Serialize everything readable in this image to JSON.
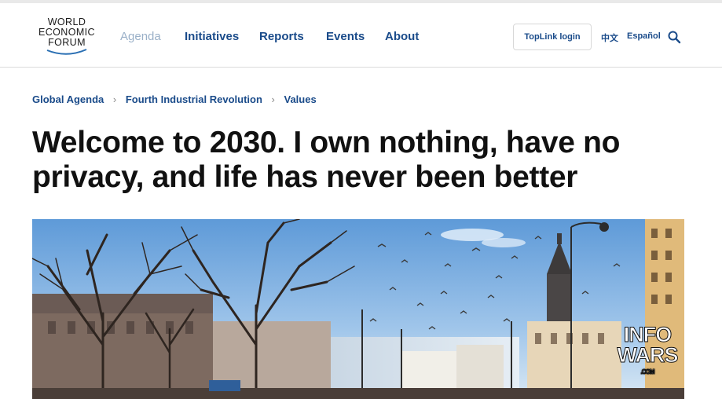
{
  "logo": {
    "line1": "WORLD",
    "line2": "ECONOMIC",
    "line3": "FORUM"
  },
  "nav": {
    "items": [
      "Agenda",
      "Initiatives",
      "Reports",
      "Events",
      "About"
    ]
  },
  "toplink_label": "TopLink login",
  "languages": [
    "中文",
    "Español"
  ],
  "breadcrumb": [
    "Global Agenda",
    "Fourth Industrial Revolution",
    "Values"
  ],
  "headline": {
    "line1": "Welcome to 2030. I own nothing, have no",
    "line2": "privacy, and life has never been better"
  },
  "watermark": {
    "line1": "INFO",
    "line2": "WARS",
    "line3": ".COM"
  },
  "colors": {
    "nav_link": "#1a4b8a",
    "nav_active_muted": "#9ab0c8",
    "headline": "#111111"
  },
  "icons": {
    "search": "search-icon",
    "breadcrumb_separator": "chevron-right-icon"
  }
}
